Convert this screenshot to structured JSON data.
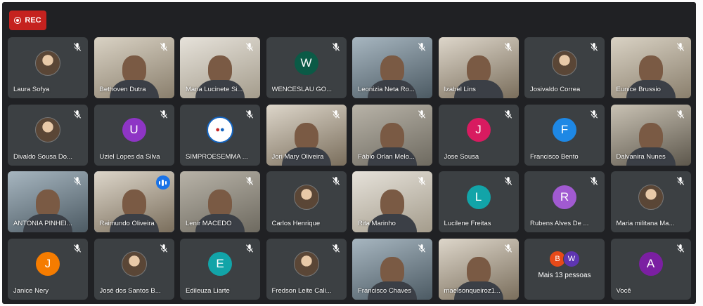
{
  "rec_label": "REC",
  "participants": [
    {
      "name": "Laura Sofya",
      "kind": "photo"
    },
    {
      "name": "Bethoven Dutra",
      "kind": "video"
    },
    {
      "name": "Maria Lucinete Si...",
      "kind": "video"
    },
    {
      "name": "WENCESLAU GO...",
      "kind": "letter",
      "letter": "W",
      "color": "#0b5a46"
    },
    {
      "name": "Leonizia Neta Ro...",
      "kind": "video"
    },
    {
      "name": "Izabel Lins",
      "kind": "video"
    },
    {
      "name": "Josivaldo Correa",
      "kind": "photo"
    },
    {
      "name": "Eunice Brussio",
      "kind": "video"
    },
    {
      "name": "Divaldo Sousa Do...",
      "kind": "photo"
    },
    {
      "name": "Uziel Lopes da Silva",
      "kind": "letter",
      "letter": "U",
      "color": "#8e35c5"
    },
    {
      "name": "SIMPROESEMMA ...",
      "kind": "logo"
    },
    {
      "name": "Jori Mary Oliveira",
      "kind": "video"
    },
    {
      "name": "Fábio Orlan Melo...",
      "kind": "video"
    },
    {
      "name": "Jose Sousa",
      "kind": "letter",
      "letter": "J",
      "color": "#d81b60"
    },
    {
      "name": "Francisco Bento",
      "kind": "letter",
      "letter": "F",
      "color": "#1e88e5"
    },
    {
      "name": "Dalvanira Nunes",
      "kind": "video"
    },
    {
      "name": "ANTONIA PINHEI...",
      "kind": "video"
    },
    {
      "name": "Raimundo Oliveira",
      "kind": "video",
      "active": true
    },
    {
      "name": "Lenir MACEDO",
      "kind": "video"
    },
    {
      "name": "Carlos Henrique",
      "kind": "photo"
    },
    {
      "name": "Rita Marinho",
      "kind": "video"
    },
    {
      "name": "Lucilene Freitas",
      "kind": "letter",
      "letter": "L",
      "color": "#12a4a8"
    },
    {
      "name": "Rubens Alves De ...",
      "kind": "letter",
      "letter": "R",
      "color": "#a15ad1"
    },
    {
      "name": "Maria militana Ma...",
      "kind": "photo"
    },
    {
      "name": "Janice Nery",
      "kind": "letter",
      "letter": "J",
      "color": "#f57c00"
    },
    {
      "name": "José dos Santos B...",
      "kind": "photo"
    },
    {
      "name": "Edileuza Liarte",
      "kind": "letter",
      "letter": "E",
      "color": "#12a4a8"
    },
    {
      "name": "Fredson Leite Cali...",
      "kind": "photo"
    },
    {
      "name": "Francisco Chaves",
      "kind": "video"
    },
    {
      "name": "maelsonqueiroz1...",
      "kind": "video"
    },
    {
      "name": "Mais 13 pessoas",
      "kind": "more",
      "mini": [
        {
          "letter": "B",
          "color": "#e64a19"
        },
        {
          "letter": "W",
          "color": "#5e35b1"
        }
      ]
    },
    {
      "name": "Você",
      "kind": "letter",
      "letter": "A",
      "color": "#7b1fa2"
    }
  ]
}
